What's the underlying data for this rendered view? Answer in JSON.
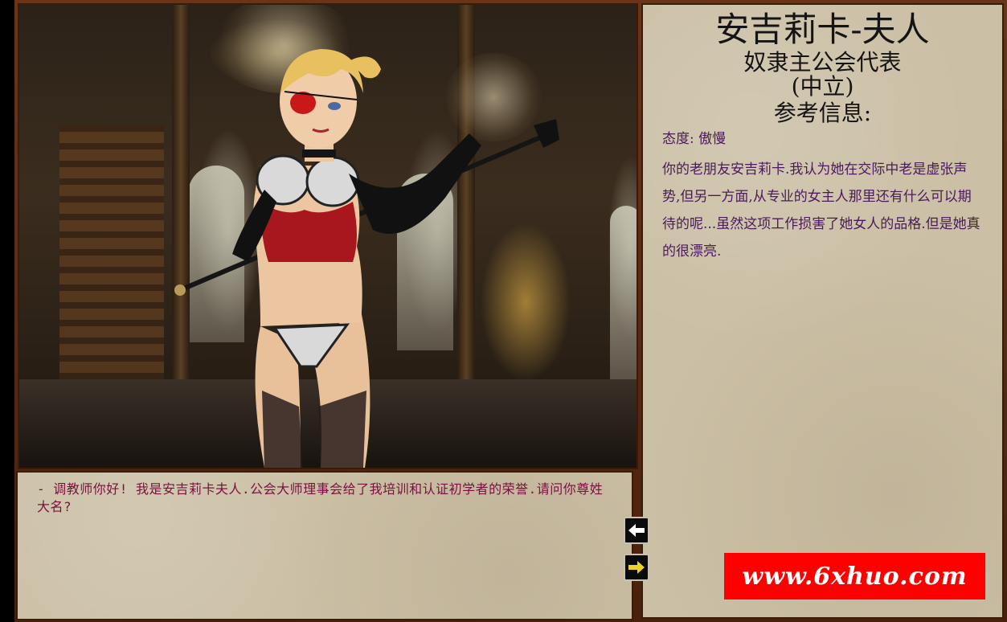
{
  "character": {
    "name": "安吉莉卡-夫人",
    "role": "奴隶主公会代表",
    "alignment": "(中立)",
    "reference_header": "参考信息:",
    "attitude": "态度: 傲慢",
    "description": "你的老朋友安吉莉卡.我认为她在交际中老是虚张声势,但另一方面,从专业的女主人那里还有什么可以期待的呢...虽然这项工作损害了她女人的品格.但是她真的很漂亮."
  },
  "dialog": {
    "text": "- 调教师你好! 我是安吉莉卡夫人.公会大师理事会给了我培训和认证初学者的荣誉.请问你尊姓大名?"
  },
  "navigation": {
    "prev_icon": "arrow-left-icon",
    "next_icon": "arrow-right-icon"
  },
  "watermark": {
    "text": "www.6xhuo.com"
  },
  "colors": {
    "panel_bg": "#cbbfa5",
    "frame": "#5a2a12",
    "dialog_text": "#7a1040",
    "info_text": "#4a1a5a",
    "watermark_bg": "#ff0000",
    "next_arrow": "#f0d020"
  }
}
